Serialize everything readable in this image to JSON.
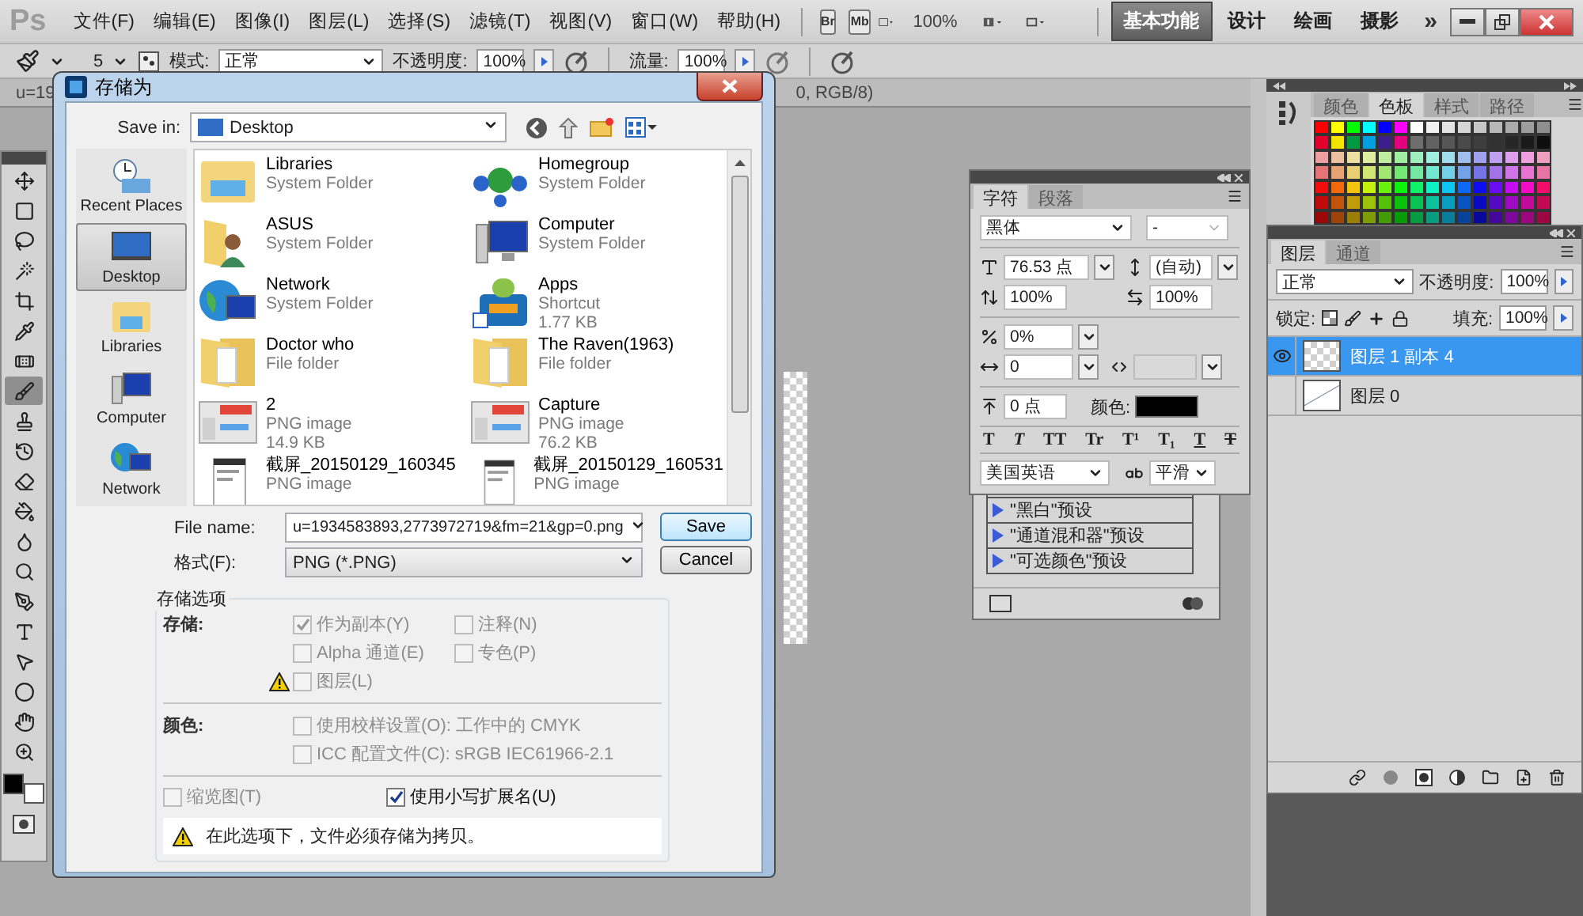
{
  "menu_bar": {
    "logo": "Ps",
    "items": [
      "文件(F)",
      "编辑(E)",
      "图像(I)",
      "图层(L)",
      "选择(S)",
      "滤镜(T)",
      "视图(V)",
      "窗口(W)",
      "帮助(H)"
    ],
    "bridge_buttons": [
      "Br",
      "Mb"
    ],
    "zoom": "100%",
    "workspaces": [
      {
        "label": "基本功能",
        "selected": true
      },
      {
        "label": "设计",
        "selected": false
      },
      {
        "label": "绘画",
        "selected": false
      },
      {
        "label": "摄影",
        "selected": false
      }
    ],
    "more": "»"
  },
  "options_bar": {
    "brush_size": "5",
    "mode_label": "模式:",
    "mode": "正常",
    "opacity_label": "不透明度:",
    "opacity": "100%",
    "flow_label": "流量:",
    "flow": "100%"
  },
  "toolbox": {
    "tools": [
      {
        "kind": "move",
        "selected": false
      },
      {
        "kind": "marquee",
        "selected": false
      },
      {
        "kind": "lasso",
        "selected": false
      },
      {
        "kind": "wand",
        "selected": false
      },
      {
        "kind": "crop",
        "selected": false
      },
      {
        "kind": "eyedropper",
        "selected": false
      },
      {
        "kind": "healing",
        "selected": false
      },
      {
        "kind": "brush",
        "selected": true
      },
      {
        "kind": "stamp",
        "selected": false
      },
      {
        "kind": "history",
        "selected": false
      },
      {
        "kind": "eraser",
        "selected": false
      },
      {
        "kind": "bucket",
        "selected": false
      },
      {
        "kind": "blur",
        "selected": false
      },
      {
        "kind": "dodge",
        "selected": false
      },
      {
        "kind": "pen",
        "selected": false
      },
      {
        "kind": "type",
        "selected": false
      },
      {
        "kind": "select",
        "selected": false
      },
      {
        "kind": "shape",
        "selected": false
      },
      {
        "kind": "hand",
        "selected": false
      },
      {
        "kind": "zoom",
        "selected": false
      }
    ]
  },
  "document_tab": {
    "title_start": "u=19",
    "title_end": "0, RGB/8)"
  },
  "save_dialog": {
    "title": "存储为",
    "save_in_label": "Save in:",
    "save_in": "Desktop",
    "places": [
      {
        "label": "Recent Places",
        "kind": "recent",
        "selected": false
      },
      {
        "label": "Desktop",
        "kind": "desktop",
        "selected": true
      },
      {
        "label": "Libraries",
        "kind": "library",
        "selected": false
      },
      {
        "label": "Computer",
        "kind": "computer",
        "selected": false
      },
      {
        "label": "Network",
        "kind": "network",
        "selected": false
      }
    ],
    "files": [
      {
        "name": "Libraries",
        "details": [
          "System Folder"
        ],
        "kind": "library"
      },
      {
        "name": "Homegroup",
        "details": [
          "System Folder"
        ],
        "kind": "homegroup"
      },
      {
        "name": "ASUS",
        "details": [
          "System Folder"
        ],
        "kind": "user"
      },
      {
        "name": "Computer",
        "details": [
          "System Folder"
        ],
        "kind": "computer"
      },
      {
        "name": "Network",
        "details": [
          "System Folder"
        ],
        "kind": "network"
      },
      {
        "name": "Apps",
        "details": [
          "Shortcut",
          "1.77 KB"
        ],
        "kind": "shortcut"
      },
      {
        "name": "Doctor who",
        "details": [
          "File folder"
        ],
        "kind": "folder"
      },
      {
        "name": "The Raven(1963)",
        "details": [
          "File folder"
        ],
        "kind": "folder"
      },
      {
        "name": "2",
        "details": [
          "PNG image",
          "14.9 KB"
        ],
        "kind": "image"
      },
      {
        "name": "Capture",
        "details": [
          "PNG image",
          "76.2 KB"
        ],
        "kind": "image"
      },
      {
        "name": "截屏_20150129_160345",
        "details": [
          "PNG image"
        ],
        "kind": "phone-image"
      },
      {
        "name": "截屏_20150129_160531",
        "details": [
          "PNG image"
        ],
        "kind": "phone-image"
      }
    ],
    "file_name_label": "File name:",
    "file_name": "u=1934583893,2773972719&fm=21&gp=0.png",
    "format_label": "格式(F):",
    "format": "PNG (*.PNG)",
    "buttons": [
      {
        "label": "Save",
        "default": true
      },
      {
        "label": "Cancel",
        "default": false
      }
    ],
    "save_options": {
      "legend": "存储选项",
      "storage_label": "存储:",
      "storage_options": [
        {
          "label": "作为副本(Y)",
          "checked": true,
          "disabled": true,
          "warning": false
        },
        {
          "label": "注释(N)",
          "checked": false,
          "disabled": true,
          "warning": false
        },
        {
          "label": "Alpha 通道(E)",
          "checked": false,
          "disabled": true,
          "warning": false
        },
        {
          "label": "专色(P)",
          "checked": false,
          "disabled": true,
          "warning": false
        },
        {
          "label": "图层(L)",
          "checked": false,
          "disabled": true,
          "warning": true
        }
      ],
      "color_label": "颜色:",
      "color_options": [
        {
          "label": "使用校样设置(O):  工作中的 CMYK",
          "checked": false,
          "disabled": true
        },
        {
          "label": "ICC 配置文件(C):  sRGB IEC61966-2.1",
          "checked": false,
          "disabled": true
        }
      ],
      "thumbnail": {
        "label": "缩览图(T)",
        "checked": false,
        "disabled": true
      },
      "lowercase": {
        "label": "使用小写扩展名(U)",
        "checked": true,
        "disabled": false
      },
      "notice": "在此选项下，文件必须存储为拷贝。"
    }
  },
  "adjustments_panel": {
    "presets": [
      "\"黑白\"预设",
      "\"通道混和器\"预设",
      "\"可选颜色\"预设"
    ]
  },
  "character_panel": {
    "tabs": [
      {
        "label": "字符",
        "selected": true
      },
      {
        "label": "段落",
        "selected": false
      }
    ],
    "font": "黑体",
    "style": "-",
    "size": "76.53 点",
    "leading": "(自动)",
    "vertical_scale": "100%",
    "horizontal_scale": "100%",
    "tsume": "0%",
    "kerning": "0",
    "baseline": "0 点",
    "color_field": {
      "label": "颜色:",
      "color": "#000000"
    },
    "style_buttons": [
      {
        "label": "T",
        "kind": "bold"
      },
      {
        "label": "T",
        "kind": "italic"
      },
      {
        "label": "TT",
        "kind": "caps"
      },
      {
        "label": "Tr",
        "kind": "small-caps"
      },
      {
        "label": "T¹",
        "kind": "super"
      },
      {
        "label": "T₁",
        "kind": "sub"
      },
      {
        "label": "T",
        "kind": "underline"
      },
      {
        "label": "T",
        "kind": "strike"
      }
    ],
    "language": "美国英语",
    "antialias": "平滑"
  },
  "swatches_panel": {
    "tabs": [
      {
        "label": "颜色",
        "selected": false
      },
      {
        "label": "色板",
        "selected": true
      },
      {
        "label": "样式",
        "selected": false
      },
      {
        "label": "路径",
        "selected": false
      }
    ]
  },
  "layers_panel": {
    "tabs": [
      {
        "label": "图层",
        "selected": true
      },
      {
        "label": "通道",
        "selected": false
      }
    ],
    "blend_mode": "正常",
    "opacity_label": "不透明度:",
    "opacity": "100%",
    "lock_label": "锁定:",
    "fill_label": "填充:",
    "fill": "100%",
    "layers": [
      {
        "name": "图层 1 副本 4",
        "visible": true,
        "selected": true,
        "kind": "transparent"
      },
      {
        "name": "图层 0",
        "visible": false,
        "selected": false,
        "kind": "sketch"
      }
    ]
  }
}
